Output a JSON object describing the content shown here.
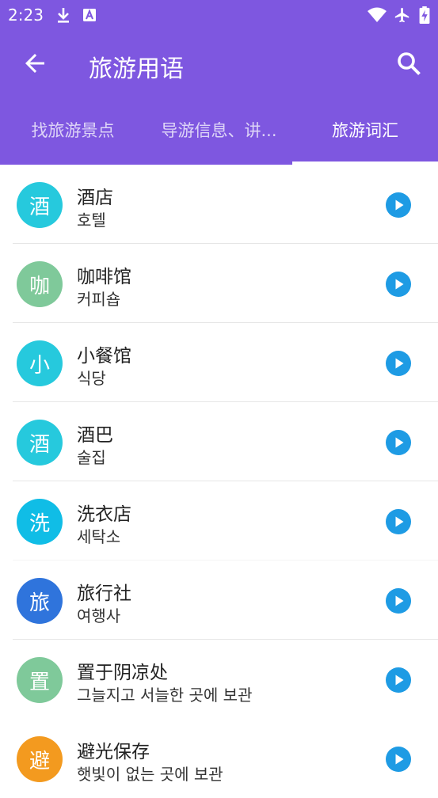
{
  "status": {
    "time": "2:23"
  },
  "appbar": {
    "title": "旅游用语",
    "back_icon": "arrow-back-icon",
    "search_icon": "search-icon"
  },
  "tabs": [
    {
      "label": "找旅游景点",
      "active": false
    },
    {
      "label": "导游信息、讲...",
      "active": false
    },
    {
      "label": "旅游词汇",
      "active": true
    }
  ],
  "items": [
    {
      "avatar_char": "酒",
      "color": "#26c9dd",
      "title": "酒店",
      "subtitle": "호텔"
    },
    {
      "avatar_char": "咖",
      "color": "#7fc99a",
      "title": "咖啡馆",
      "subtitle": "커피숍"
    },
    {
      "avatar_char": "小",
      "color": "#26c9dd",
      "title": "小餐馆",
      "subtitle": "식당"
    },
    {
      "avatar_char": "酒",
      "color": "#26c9dd",
      "title": "酒巴",
      "subtitle": "술집"
    },
    {
      "avatar_char": "洗",
      "color": "#10bde6",
      "title": "洗衣店",
      "subtitle": "세탁소"
    },
    {
      "avatar_char": "旅",
      "color": "#2f74dc",
      "title": "旅行社",
      "subtitle": "여행사"
    },
    {
      "avatar_char": "置",
      "color": "#7fc99a",
      "title": "置于阴凉处",
      "subtitle": "그늘지고 서늘한 곳에 보관"
    },
    {
      "avatar_char": "避",
      "color": "#f39a1f",
      "title": "避光保存",
      "subtitle": "햇빛이 없는 곳에 보관"
    }
  ],
  "colors": {
    "primary": "#7e57e0",
    "play": "#1e9be4"
  }
}
